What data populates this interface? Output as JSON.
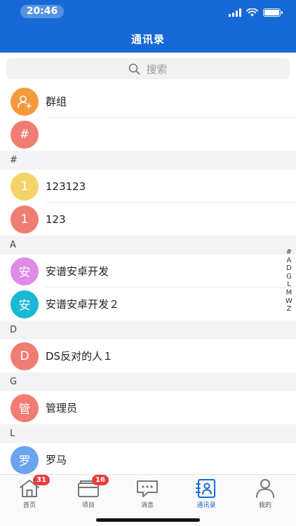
{
  "status": {
    "time": "20:46"
  },
  "header": {
    "title": "通讯录"
  },
  "search": {
    "placeholder": "搜索"
  },
  "top_rows": [
    {
      "label": "群组",
      "avatar_color": "#f59a3c",
      "icon": "group-add-icon"
    },
    {
      "label": "",
      "avatar_text": "#",
      "avatar_color": "#ef7d72"
    }
  ],
  "sections": [
    {
      "letter": "#",
      "rows": [
        {
          "avatar_text": "1",
          "avatar_color": "#f5d36b",
          "label": "123123"
        },
        {
          "avatar_text": "1",
          "avatar_color": "#ef7d72",
          "label": "123"
        }
      ]
    },
    {
      "letter": "A",
      "rows": [
        {
          "avatar_text": "安",
          "avatar_color": "#e08ae8",
          "label": "安谱安卓开发"
        },
        {
          "avatar_text": "安",
          "avatar_color": "#1ab8d4",
          "label": "安谱安卓开发２"
        }
      ]
    },
    {
      "letter": "D",
      "rows": [
        {
          "avatar_text": "D",
          "avatar_color": "#ef7d72",
          "label": "DS反对的人１"
        }
      ]
    },
    {
      "letter": "G",
      "rows": [
        {
          "avatar_text": "管",
          "avatar_color": "#ef7d72",
          "label": "管理员"
        }
      ]
    },
    {
      "letter": "L",
      "rows": [
        {
          "avatar_text": "罗",
          "avatar_color": "#6aa3ef",
          "label": "罗马"
        }
      ]
    }
  ],
  "index_letters": [
    "#",
    "A",
    "D",
    "G",
    "L",
    "M",
    "W",
    "Z"
  ],
  "tabs": [
    {
      "label": "首页",
      "badge": "31",
      "icon": "home-icon"
    },
    {
      "label": "项目",
      "badge": "16",
      "icon": "project-icon"
    },
    {
      "label": "消息",
      "badge": "",
      "icon": "message-icon"
    },
    {
      "label": "通讯录",
      "badge": "",
      "icon": "contacts-icon",
      "active": true
    },
    {
      "label": "我的",
      "badge": "",
      "icon": "profile-icon"
    }
  ],
  "colors": {
    "primary": "#1769d8",
    "badge": "#e93c3c"
  }
}
